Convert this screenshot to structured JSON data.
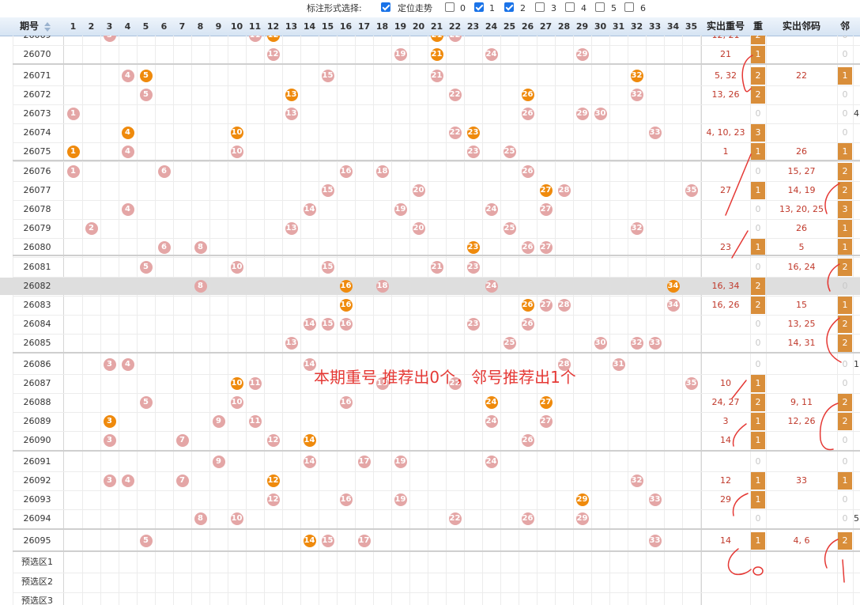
{
  "options": {
    "label": "标注形式选择:",
    "items": [
      {
        "label": "定位走势",
        "checked": true
      },
      {
        "label": "0",
        "checked": false
      },
      {
        "label": "1",
        "checked": true
      },
      {
        "label": "2",
        "checked": true
      },
      {
        "label": "3",
        "checked": false
      },
      {
        "label": "4",
        "checked": false
      },
      {
        "label": "5",
        "checked": false
      },
      {
        "label": "6",
        "checked": false
      }
    ]
  },
  "header": {
    "period": "期号",
    "sort_icon": "sort-icon",
    "numbers": [
      "1",
      "2",
      "3",
      "4",
      "5",
      "6",
      "7",
      "8",
      "9",
      "10",
      "11",
      "12",
      "13",
      "14",
      "15",
      "16",
      "17",
      "18",
      "19",
      "20",
      "21",
      "22",
      "23",
      "24",
      "25",
      "26",
      "27",
      "28",
      "29",
      "30",
      "31",
      "32",
      "33",
      "34",
      "35"
    ],
    "repeat": "实出重号",
    "repeat_count": "重",
    "neighbor": "实出邻码",
    "neighbor_count": "邻"
  },
  "colors": {
    "pink": "#e4a6a6",
    "orange": "#ef8a0c",
    "count_bg": "#d98e3a",
    "annotation": "#e53935"
  },
  "rows": [
    {
      "period": "26069",
      "pink": [
        3,
        11,
        22
      ],
      "orange": [
        12,
        21
      ],
      "repeat": "12, 21",
      "rep_cnt": "2",
      "neighbor": "",
      "nb_cnt": "0",
      "extra": ""
    },
    {
      "period": "26070",
      "pink": [
        12,
        19,
        24,
        29
      ],
      "orange": [
        21
      ],
      "repeat": "21",
      "rep_cnt": "1",
      "neighbor": "",
      "nb_cnt": "0",
      "extra": ""
    },
    {
      "period": "26071",
      "pink": [
        4,
        15,
        21
      ],
      "orange": [
        5,
        32
      ],
      "repeat": "5, 32",
      "rep_cnt": "2",
      "neighbor": "22",
      "nb_cnt": "1",
      "extra": ""
    },
    {
      "period": "26072",
      "pink": [
        5,
        22,
        32
      ],
      "orange": [
        13,
        26
      ],
      "repeat": "13, 26",
      "rep_cnt": "2",
      "neighbor": "",
      "nb_cnt": "0",
      "extra": ""
    },
    {
      "period": "26073",
      "pink": [
        1,
        13,
        26,
        29,
        30
      ],
      "orange": [],
      "repeat": "",
      "rep_cnt": "0",
      "neighbor": "",
      "nb_cnt": "0",
      "extra": "4"
    },
    {
      "period": "26074",
      "pink": [
        22,
        33
      ],
      "orange": [
        4,
        10,
        23
      ],
      "repeat": "4, 10, 23",
      "rep_cnt": "3",
      "neighbor": "",
      "nb_cnt": "0",
      "extra": ""
    },
    {
      "period": "26075",
      "pink": [
        4,
        10,
        23,
        25
      ],
      "orange": [
        1
      ],
      "repeat": "1",
      "rep_cnt": "1",
      "neighbor": "26",
      "nb_cnt": "1",
      "extra": ""
    },
    {
      "period": "26076",
      "pink": [
        1,
        6,
        16,
        18,
        26
      ],
      "orange": [],
      "repeat": "",
      "rep_cnt": "0",
      "neighbor": "15, 27",
      "nb_cnt": "2",
      "extra": ""
    },
    {
      "period": "26077",
      "pink": [
        15,
        20,
        28,
        35
      ],
      "orange": [
        27
      ],
      "repeat": "27",
      "rep_cnt": "1",
      "neighbor": "14, 19",
      "nb_cnt": "2",
      "extra": ""
    },
    {
      "period": "26078",
      "pink": [
        4,
        14,
        19,
        24,
        27
      ],
      "orange": [],
      "repeat": "",
      "rep_cnt": "0",
      "neighbor": "13, 20, 25",
      "nb_cnt": "3",
      "extra": ""
    },
    {
      "period": "26079",
      "pink": [
        2,
        13,
        20,
        25,
        32
      ],
      "orange": [],
      "repeat": "",
      "rep_cnt": "0",
      "neighbor": "26",
      "nb_cnt": "1",
      "extra": ""
    },
    {
      "period": "26080",
      "pink": [
        6,
        8,
        26,
        27
      ],
      "orange": [
        23
      ],
      "repeat": "23",
      "rep_cnt": "1",
      "neighbor": "5",
      "nb_cnt": "1",
      "extra": ""
    },
    {
      "period": "26081",
      "pink": [
        5,
        10,
        15,
        21,
        23
      ],
      "orange": [],
      "repeat": "",
      "rep_cnt": "0",
      "neighbor": "16, 24",
      "nb_cnt": "2",
      "extra": ""
    },
    {
      "period": "26082",
      "pink": [
        8,
        18,
        24
      ],
      "orange": [
        16,
        34
      ],
      "repeat": "16, 34",
      "rep_cnt": "2",
      "neighbor": "",
      "nb_cnt": "0",
      "extra": "",
      "highlight": true
    },
    {
      "period": "26083",
      "pink": [
        27,
        28,
        34
      ],
      "orange": [
        16,
        26
      ],
      "repeat": "16, 26",
      "rep_cnt": "2",
      "neighbor": "15",
      "nb_cnt": "1",
      "extra": ""
    },
    {
      "period": "26084",
      "pink": [
        14,
        15,
        16,
        23,
        26
      ],
      "orange": [],
      "repeat": "",
      "rep_cnt": "0",
      "neighbor": "13, 25",
      "nb_cnt": "2",
      "extra": ""
    },
    {
      "period": "26085",
      "pink": [
        13,
        25,
        30,
        32,
        33
      ],
      "orange": [],
      "repeat": "",
      "rep_cnt": "0",
      "neighbor": "14, 31",
      "nb_cnt": "2",
      "extra": ""
    },
    {
      "period": "26086",
      "pink": [
        3,
        4,
        14,
        28,
        31
      ],
      "orange": [],
      "repeat": "",
      "rep_cnt": "0",
      "neighbor": "",
      "nb_cnt": "0",
      "extra": "1"
    },
    {
      "period": "26087",
      "pink": [
        11,
        18,
        22,
        35
      ],
      "orange": [
        10
      ],
      "repeat": "10",
      "rep_cnt": "1",
      "neighbor": "",
      "nb_cnt": "0",
      "extra": ""
    },
    {
      "period": "26088",
      "pink": [
        5,
        10,
        16
      ],
      "orange": [
        24,
        27
      ],
      "repeat": "24, 27",
      "rep_cnt": "2",
      "neighbor": "9, 11",
      "nb_cnt": "2",
      "extra": ""
    },
    {
      "period": "26089",
      "pink": [
        9,
        11,
        24,
        27
      ],
      "orange": [
        3
      ],
      "repeat": "3",
      "rep_cnt": "1",
      "neighbor": "12, 26",
      "nb_cnt": "2",
      "extra": ""
    },
    {
      "period": "26090",
      "pink": [
        3,
        7,
        12,
        26
      ],
      "orange": [
        14
      ],
      "repeat": "14",
      "rep_cnt": "1",
      "neighbor": "",
      "nb_cnt": "0",
      "extra": ""
    },
    {
      "period": "26091",
      "pink": [
        9,
        14,
        17,
        19,
        24
      ],
      "orange": [],
      "repeat": "",
      "rep_cnt": "0",
      "neighbor": "",
      "nb_cnt": "0",
      "extra": ""
    },
    {
      "period": "26092",
      "pink": [
        3,
        4,
        7,
        32
      ],
      "orange": [
        12
      ],
      "repeat": "12",
      "rep_cnt": "1",
      "neighbor": "33",
      "nb_cnt": "1",
      "extra": ""
    },
    {
      "period": "26093",
      "pink": [
        12,
        16,
        19,
        33
      ],
      "orange": [
        29
      ],
      "repeat": "29",
      "rep_cnt": "1",
      "neighbor": "",
      "nb_cnt": "0",
      "extra": ""
    },
    {
      "period": "26094",
      "pink": [
        8,
        10,
        22,
        26,
        29
      ],
      "orange": [],
      "repeat": "",
      "rep_cnt": "0",
      "neighbor": "",
      "nb_cnt": "0",
      "extra": "5"
    },
    {
      "period": "26095",
      "pink": [
        5,
        15,
        17,
        33
      ],
      "orange": [
        14
      ],
      "repeat": "14",
      "rep_cnt": "1",
      "neighbor": "4, 6",
      "nb_cnt": "2",
      "extra": ""
    }
  ],
  "preselect": [
    "预选区1",
    "预选区2",
    "预选区3"
  ],
  "annotation": "本期重号 推荐出0个，邻号推荐出1个"
}
